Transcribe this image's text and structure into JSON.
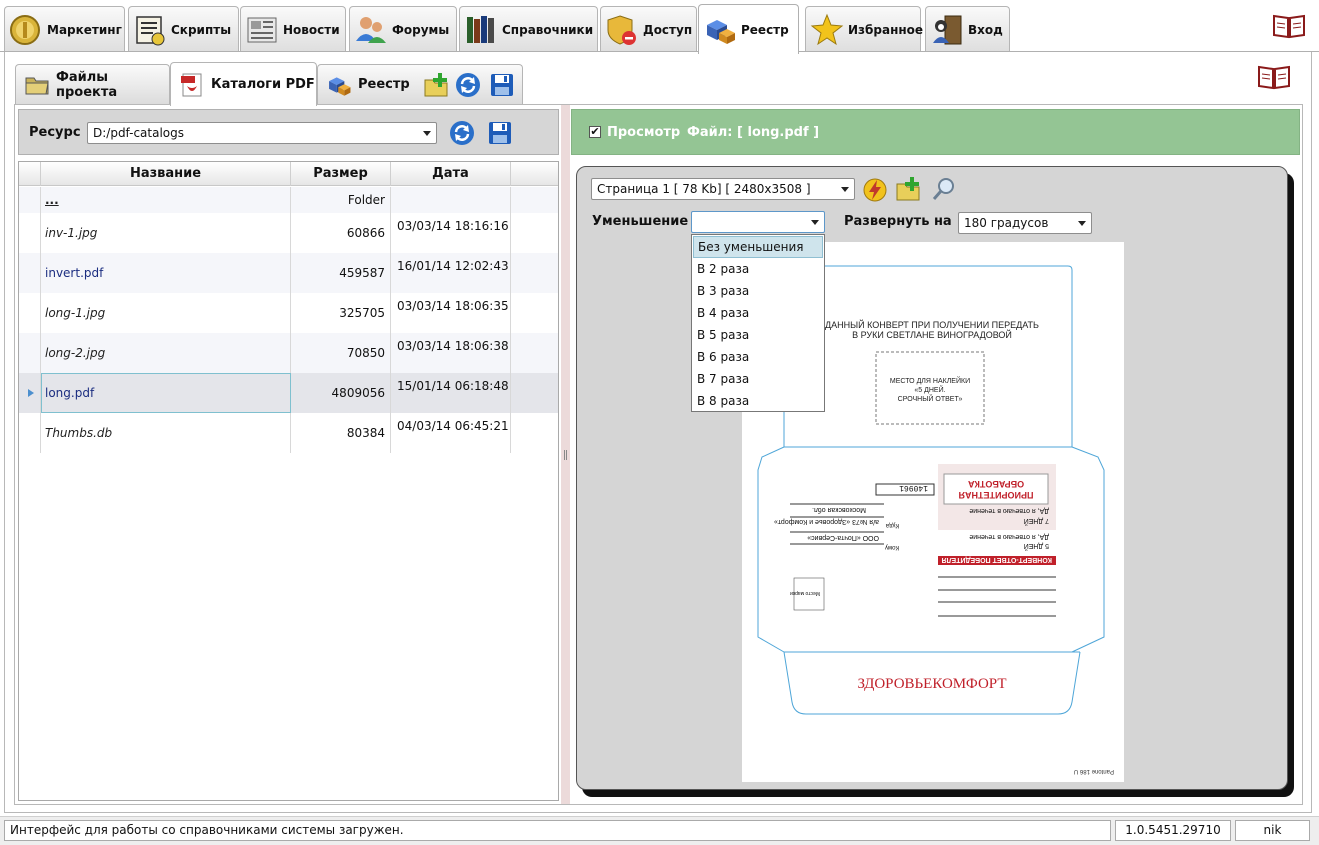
{
  "top_tabs": [
    {
      "label": "Маркетинг",
      "icon": "coin-icon"
    },
    {
      "label": "Скрипты",
      "icon": "script-icon"
    },
    {
      "label": "Новости",
      "icon": "newspaper-icon"
    },
    {
      "label": "Форумы",
      "icon": "users-icon"
    },
    {
      "label": "Справочники",
      "icon": "books-icon"
    },
    {
      "label": "Доступ",
      "icon": "shield-icon"
    },
    {
      "label": "Реестр",
      "icon": "registry-icon",
      "active": true
    },
    {
      "label": "Избранное",
      "icon": "star-icon"
    },
    {
      "label": "Вход",
      "icon": "login-icon"
    }
  ],
  "sub_tabs": [
    {
      "label": "Файлы проекта",
      "icon": "folder-icon"
    },
    {
      "label": "Каталоги PDF",
      "icon": "pdf-icon",
      "active": true
    },
    {
      "label": "Реестр",
      "icon": "registry-icon"
    }
  ],
  "resource": {
    "label": "Ресурс",
    "value": "D:/pdf-catalogs"
  },
  "grid": {
    "columns": [
      "Название",
      "Размер",
      "Дата"
    ],
    "rows": [
      {
        "name": "...",
        "size": "Folder",
        "date": ""
      },
      {
        "name": "inv-1.jpg",
        "size": "60866",
        "date": "03/03/14 18:16:16"
      },
      {
        "name": "invert.pdf",
        "size": "459587",
        "date": "16/01/14 12:02:43"
      },
      {
        "name": "long-1.jpg",
        "size": "325705",
        "date": "03/03/14 18:06:35"
      },
      {
        "name": "long-2.jpg",
        "size": "70850",
        "date": "03/03/14 18:06:38"
      },
      {
        "name": "long.pdf",
        "size": "4809056",
        "date": "15/01/14 06:18:48"
      },
      {
        "name": "Thumbs.db",
        "size": "80384",
        "date": "04/03/14 06:45:21"
      }
    ]
  },
  "preview": {
    "check_mark": "✔",
    "label": "Просмотр",
    "file_label": "Файл: [ long.pdf ]"
  },
  "viewer": {
    "page_select": "Страница 1 [ 78 Kb] [ 2480x3508 ]",
    "reduce_label": "Уменьшение",
    "reduce_value": "",
    "rotate_label": "Развернуть на",
    "rotate_value": "180 градусов",
    "reduce_options": [
      "Без уменьшения",
      "В 2 раза",
      "В 3 раза",
      "В 4 раза",
      "В 5 раза",
      "В 6 раза",
      "В 7 раза",
      "В 8 раза"
    ]
  },
  "document": {
    "line1": "ДАННЫЙ КОНВЕРТ ПРИ ПОЛУЧЕНИИ ПЕРЕДАТЬ",
    "line2": "В РУКИ СВЕТЛАНЕ ВИНОГРАДОВОЙ",
    "sticker1": "МЕСТО ДЛЯ НАКЛЕЙКИ",
    "sticker2": "«5 ДНЕЙ.",
    "sticker3": "СРОЧНЫЙ ОТВЕТ»",
    "index_number": "140961",
    "postal_code": "140961",
    "priority1": "ПРИОРИТЕТНАЯ",
    "priority2": "ОБРАБОТКА",
    "days7": "7 ДНЕЙ",
    "days5": "5 ДНЕЙ",
    "yes_reply": "ДА, я отвечаю в течение",
    "banner": "КОНВЕРТ-ОТВЕТ ПОБЕДИТЕЛЯ",
    "addr1": "ООО «Почта-Сервис»",
    "addr2": "а/я №73 «Здоровье и Комфорт»",
    "addr3": "Московская обл.",
    "kuda": "Куда",
    "komu": "Кому",
    "place": "Место марки",
    "brand": "ЗДОРОВЬЕКОМФОРТ",
    "pantone": "Pantone 186 U"
  },
  "status": {
    "message": "Интерфейс для работы со справочниками системы загружен.",
    "version": "1.0.5451.29710",
    "user": "nik"
  },
  "colors": {
    "preview_bar": "#94c594",
    "accent_blue": "#1b2d80",
    "brand_red": "#c0202a"
  }
}
